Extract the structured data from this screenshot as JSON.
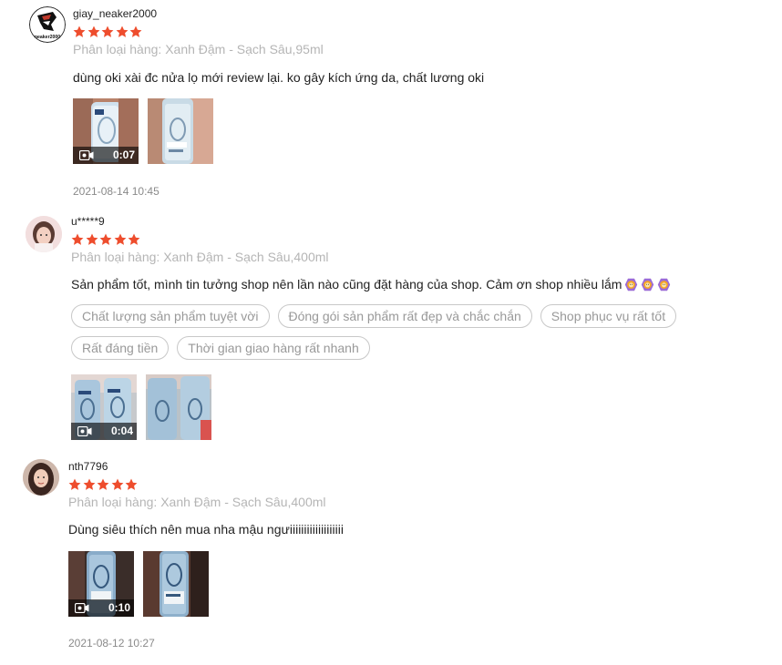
{
  "reviews": [
    {
      "username": "giay_neaker2000",
      "avatar_text": "neaker2000",
      "rating": 5,
      "variation": "Phân loại hàng: Xanh Đậm - Sạch Sâu,95ml",
      "comment": "dùng oki xài đc nửa lọ mới review lại. ko gây kích ứng da, chất lương oki",
      "tags": [],
      "media": {
        "video_duration": "0:07",
        "images": 1
      },
      "date": "2021-08-14 10:45"
    },
    {
      "username": "u*****9",
      "rating": 5,
      "variation": "Phân loại hàng: Xanh Đậm - Sạch Sâu,400ml",
      "comment": "Sản phẩm tốt, mình tin tưởng shop nên lần nào cũng đặt hàng của shop. Cảm ơn shop nhiều lắm",
      "comment_emojis": [
        "lion-emoji",
        "lion-emoji",
        "lion-emoji"
      ],
      "tags": [
        "Chất lượng sản phẩm tuyệt vời",
        "Đóng gói sản phẩm rất đẹp và chắc chắn",
        "Shop phục vụ rất tốt",
        "Rất đáng tiền",
        "Thời gian giao hàng rất nhanh"
      ],
      "media": {
        "video_duration": "0:04",
        "images": 1
      }
    },
    {
      "username": "nth7796",
      "rating": 5,
      "variation": "Phân loại hàng: Xanh Đậm - Sạch Sâu,400ml",
      "comment": "Dùng siêu thích nên mua nha mậu ngưiiiiiiiiiiiiiiiiiii",
      "tags": [],
      "media": {
        "video_duration": "0:10",
        "images": 1
      },
      "date": "2021-08-12 10:27"
    }
  ],
  "colors": {
    "star": "#ee4d2d",
    "tag_border": "#c8c8c8",
    "muted": "#b5b5b5"
  },
  "icons": {
    "star": "star-icon",
    "video": "video-camera-icon"
  }
}
